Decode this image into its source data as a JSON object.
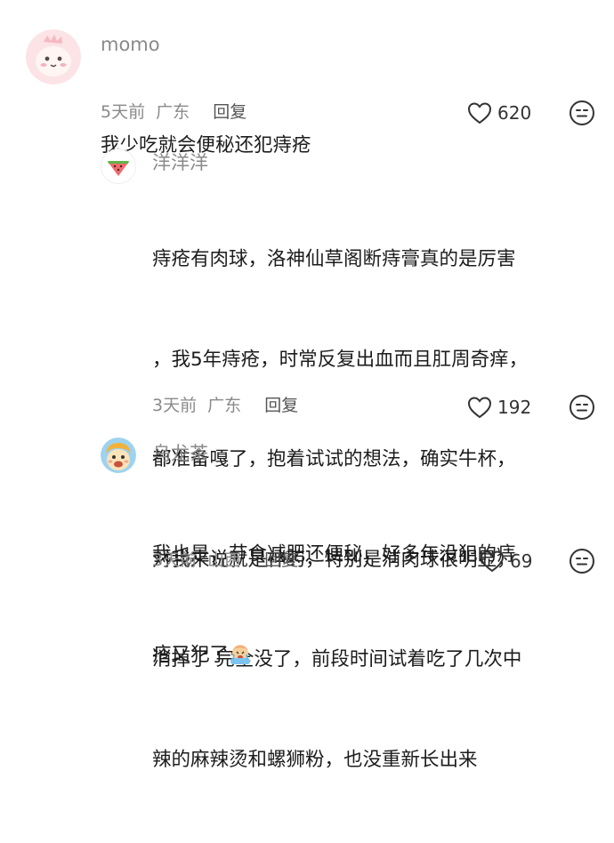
{
  "comments": [
    {
      "username": "momo",
      "avatar_icon": "pink-dinosaur-avatar-icon",
      "text_lines": [
        "我少吃就会便秘还犯痔疮"
      ],
      "time": "5天前",
      "location": "广东",
      "reply_label": "回复",
      "likes": "620"
    },
    {
      "username": "洋洋洋",
      "avatar_icon": "watermelon-avatar-icon",
      "text_lines": [
        "痔疮有肉球，洛神仙草阁断痔膏真的是厉害",
        "，我5年痔疮，时常反复出血而且肛周奇痒，",
        "都准备嘎了，抱着试试的想法，确实牛杯，",
        "对我来说就是神药，特别是消肉球很明显，",
        "消掉了 完全没了，前段时间试着吃了几次中",
        "辣的麻辣烫和螺狮粉，也没重新长出来"
      ],
      "time": "3天前",
      "location": "广东",
      "reply_label": "回复",
      "likes": "192"
    },
    {
      "username": "乌龙茶",
      "avatar_icon": "cartoon-character-avatar-icon",
      "text_lines": [
        "我也是，节食减肥还便秘，好多年没犯的痔",
        "疮又犯了"
      ],
      "inline_emoji": "crying-emoji-icon",
      "time": "3天前",
      "location": "山西",
      "reply_label": "回复",
      "likes": "69"
    }
  ],
  "icons": {
    "like": "heart-outline-icon",
    "reaction": "neutral-face-icon"
  },
  "colors": {
    "name": "#8a8a8a",
    "text": "#1c1c1c",
    "meta": "#8a8a8a",
    "icon_stroke": "#333333"
  }
}
